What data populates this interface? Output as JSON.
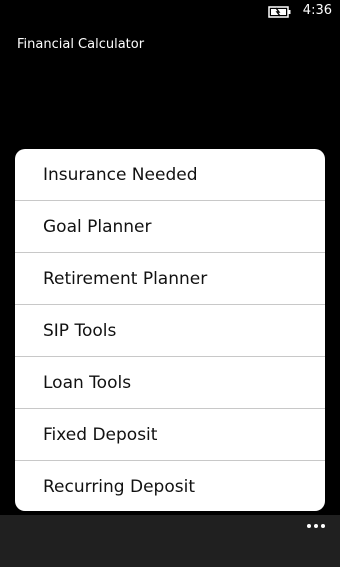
{
  "status_bar": {
    "time": "4:36",
    "battery_icon": "battery-charging-icon"
  },
  "app": {
    "title": "Financial Calculator"
  },
  "menu": {
    "items": [
      {
        "label": "Insurance Needed"
      },
      {
        "label": "Goal Planner"
      },
      {
        "label": "Retirement Planner"
      },
      {
        "label": "SIP Tools"
      },
      {
        "label": "Loan Tools"
      },
      {
        "label": "Fixed Deposit"
      },
      {
        "label": "Recurring Deposit"
      }
    ]
  },
  "app_bar": {
    "more_icon": "ellipsis-icon"
  },
  "colors": {
    "background": "#000000",
    "card": "#ffffff",
    "app_bar": "#202020",
    "divider": "#c8c8c8"
  }
}
